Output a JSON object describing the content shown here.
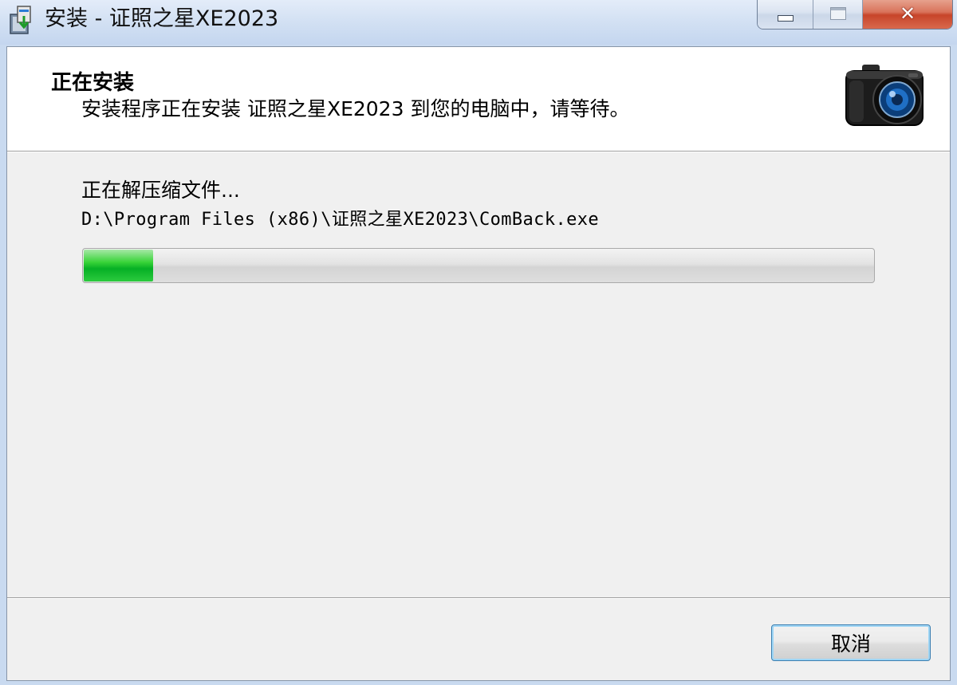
{
  "window": {
    "title": "安装 - 证照之星XE2023",
    "controls": {
      "minimize_icon": "minimize-icon",
      "maximize_icon": "maximize-icon",
      "close_icon": "close-icon"
    }
  },
  "header": {
    "title": "正在安装",
    "subtitle": "安装程序正在安装 证照之星XE2023 到您的电脑中，请等待。",
    "logo_icon": "camera-icon"
  },
  "main": {
    "status_text": "正在解压缩文件...",
    "current_file": "D:\\Program Files (x86)\\证照之星XE2023\\ComBack.exe",
    "progress": {
      "fraction": 0.09,
      "color": "#06b025"
    }
  },
  "footer": {
    "cancel_label": "取消"
  }
}
